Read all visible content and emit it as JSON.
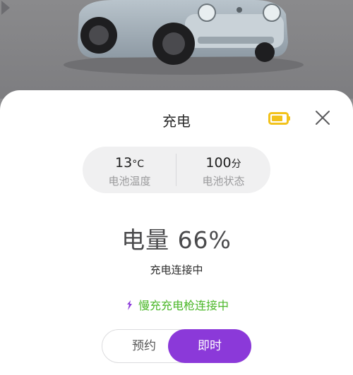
{
  "header": {
    "title": "充电"
  },
  "stats": {
    "temperature": {
      "value": "13",
      "unit": "°C",
      "label": "电池温度"
    },
    "state": {
      "value": "100",
      "unit": "分",
      "label": "电池状态"
    }
  },
  "charge": {
    "label": "电量",
    "percent_text": "66%",
    "status": "充电连接中"
  },
  "gun": {
    "text": "慢充充电枪连接中"
  },
  "mode_toggle": {
    "reserve_label": "预约",
    "now_label": "即时",
    "selected": "now"
  },
  "colors": {
    "accent_purple": "#8b39d9",
    "success_green": "#4cb82a",
    "battery_yellow": "#f2c21b"
  },
  "icons": {
    "battery": "battery-icon",
    "close": "close-icon",
    "plug": "plug-icon",
    "next": "chevron-right-icon"
  }
}
